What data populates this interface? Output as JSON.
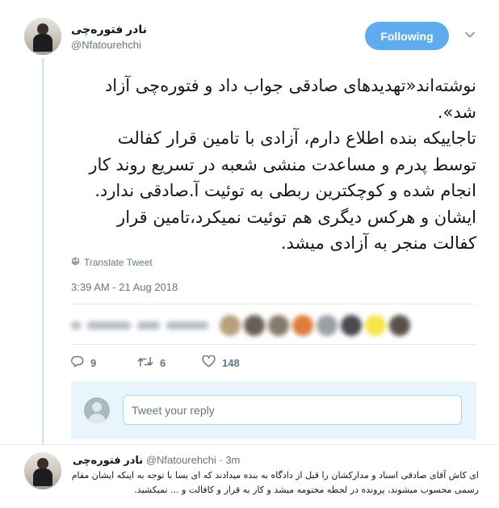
{
  "tweet": {
    "author": {
      "display_name": "نادر فتوره‌چی",
      "handle": "@Nfatourehchi"
    },
    "follow_label": "Following",
    "text_lines": [
      "نوشته‌اند«تهدیدهای صادقی جواب داد و فتوره‌چی آزاد",
      "شد».",
      "تاجاییکه بنده اطلاع دارم، آزادی با تامین قرار کفالت",
      "توسط پدرم و مساعدت منشی شعبه در تسریع روند کار",
      "انجام شده و کوچکترین ربطی به توئیت آ.صادقی ندارد.",
      "ایشان و هرکس دیگری هم توئیت نمیکرد،تامین قرار",
      "کفالت منجر به آزادی میشد."
    ],
    "translate_label": "Translate Tweet",
    "timestamp": "3:39 AM - 21 Aug 2018",
    "counts": {
      "replies": "9",
      "retweets": "6",
      "likes": "148"
    },
    "icons": {
      "globe": "globe-icon",
      "reply": "reply-icon",
      "retweet": "retweet-icon",
      "like": "heart-icon",
      "caret": "chevron-down-icon"
    },
    "colors": {
      "accent": "#1da1f2",
      "follow_bg": "#5eacee",
      "muted": "#657786",
      "reply_area_bg": "#e8f5fd"
    }
  },
  "reply_box": {
    "placeholder": "Tweet your reply"
  },
  "reply_tweet": {
    "display_name": "نادر فتوره‌چی",
    "handle": "@Nfatourehchi",
    "separator": "·",
    "time": "3m",
    "text_lines": [
      "ای کاش آقای صادقی اسناد و مدارکشان را قبل از دادگاه به بنده میدادند که ای بسا با توجه به اینکه ایشان مقام",
      "رسمی محسوب میشوند، پرونده در لحظه مختومه میشد و کار به قرار و کافالت و ... نمیکشید."
    ]
  }
}
